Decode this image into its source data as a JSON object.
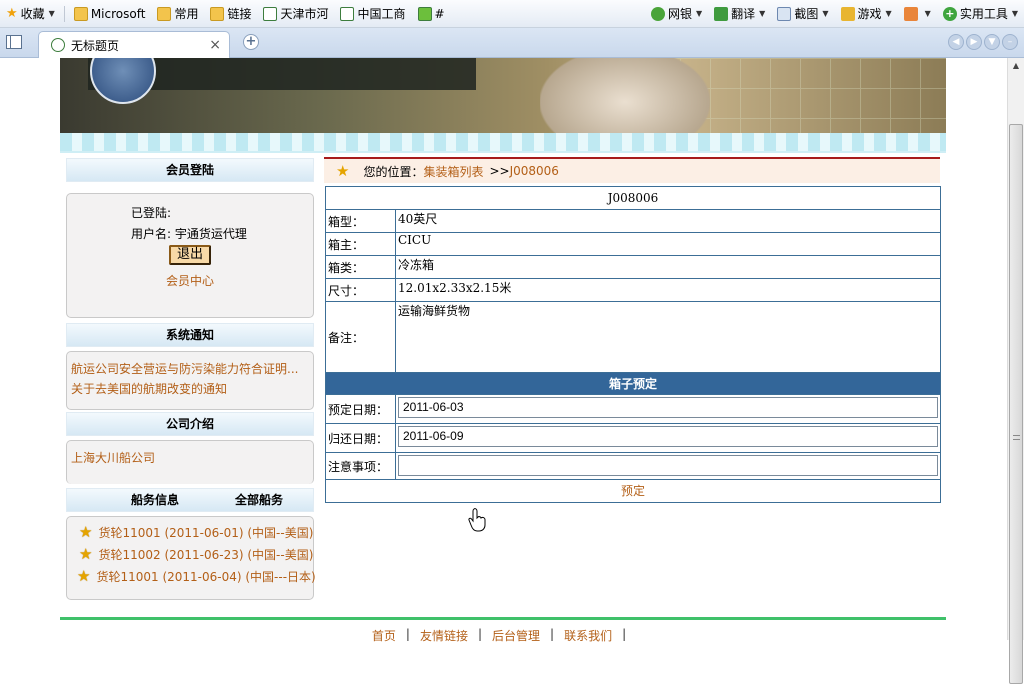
{
  "browser": {
    "favorites": [
      {
        "label": "收藏",
        "icon": "star-icon"
      },
      {
        "label": "Microsoft",
        "icon": "folder-icon"
      },
      {
        "label": "常用",
        "icon": "folder-icon"
      },
      {
        "label": "链接",
        "icon": "folder-icon"
      },
      {
        "label": "天津市河",
        "icon": "page-icon"
      },
      {
        "label": "中国工商",
        "icon": "page-icon"
      },
      {
        "label": "#",
        "icon": "page-icon"
      }
    ],
    "tools": [
      {
        "label": "网银",
        "icon": "globe-icon"
      },
      {
        "label": "翻译",
        "icon": "translate-icon"
      },
      {
        "label": "截图",
        "icon": "scissors-icon"
      },
      {
        "label": "游戏",
        "icon": "game-icon"
      },
      {
        "label": "",
        "icon": "app-icon"
      },
      {
        "label": "实用工具",
        "icon": "plus-icon"
      }
    ],
    "tab_title": "无标题页"
  },
  "sidebar": {
    "login": {
      "title": "会员登陆",
      "status": "已登陆:",
      "user_label": "用户名: 宇通货运代理",
      "logout": "退出",
      "member_center": "会员中心"
    },
    "notices": {
      "title": "系统通知",
      "items": [
        "航运公司安全营运与防污染能力符合证明...",
        "关于去美国的航期改变的通知"
      ]
    },
    "company": {
      "title": "公司介绍",
      "items": [
        "上海大川船公司"
      ]
    },
    "shipping": {
      "title": "船务信息",
      "all_link": "全部船务",
      "items": [
        "货轮11001 (2011-06-01) (中国--美国)",
        "货轮11002 (2011-06-23) (中国--美国)",
        "货轮11001 (2011-06-04) (中国---日本)"
      ]
    }
  },
  "location": {
    "label": "您的位置：",
    "crumb": "集装箱列表",
    "sep": ">>",
    "current": "J008006"
  },
  "detail": {
    "id": "J008006",
    "rows": [
      {
        "label": "箱型：",
        "value": "40英尺"
      },
      {
        "label": "箱主：",
        "value": "CICU"
      },
      {
        "label": "箱类：",
        "value": "冷冻箱"
      },
      {
        "label": "尺寸：",
        "value": "12.01x2.33x2.15米"
      },
      {
        "label": "备注：",
        "value": "运输海鲜货物"
      }
    ],
    "booking_title": "箱子预定",
    "booking": [
      {
        "label": "预定日期：",
        "value": "2011-06-03"
      },
      {
        "label": "归还日期：",
        "value": "2011-06-09"
      },
      {
        "label": "注意事项：",
        "value": ""
      }
    ],
    "submit": "预定"
  },
  "footer": {
    "links": [
      "首页",
      "友情链接",
      "后台管理",
      "联系我们"
    ]
  },
  "colors": {
    "link": "#b35f17",
    "section_bg": "#336699",
    "footer_line": "#3fc16a"
  }
}
